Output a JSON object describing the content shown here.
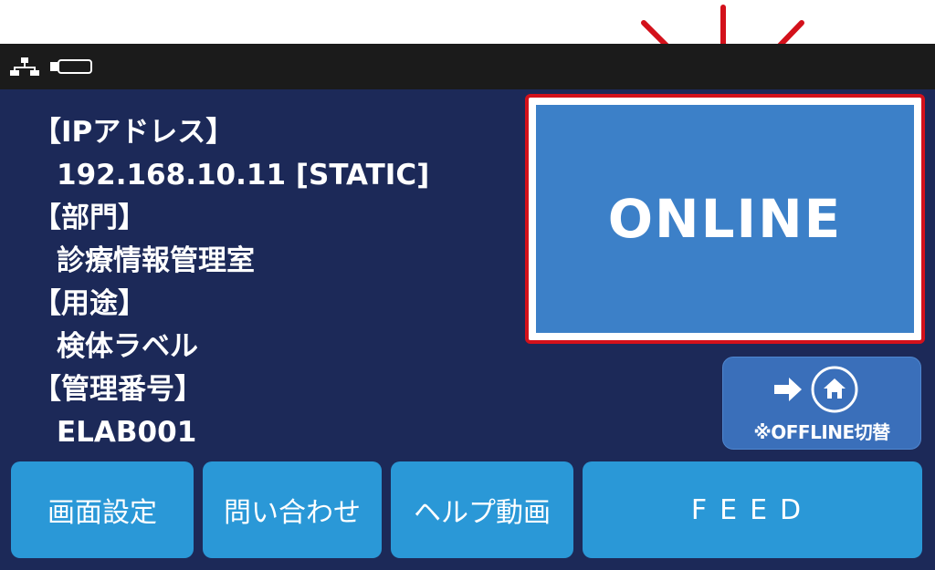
{
  "status_bar": {
    "network_icon": "network-icon",
    "storage_icon": "sd-card-icon"
  },
  "info": {
    "ip_label": "【IPアドレス】",
    "ip_value": "192.168.10.11 [STATIC]",
    "dept_label": "【部門】",
    "dept_value": "診療情報管理室",
    "use_label": "【用途】",
    "use_value": "検体ラベル",
    "mgmt_label": "【管理番号】",
    "mgmt_value": "ELAB001"
  },
  "status_panel": {
    "text": "ONLINE",
    "highlight_color": "#d3111b",
    "panel_color": "#3c80c8"
  },
  "offline_button": {
    "label": "※OFFLINE切替",
    "icons": [
      "arrow-right-icon",
      "home-icon"
    ]
  },
  "buttons": {
    "settings": "画面設定",
    "contact": "問い合わせ",
    "help_video": "ヘルプ動画",
    "feed": "FEED"
  },
  "colors": {
    "screen_bg": "#1c2958",
    "button_bg": "#2a98d7",
    "status_bar_bg": "#1b1b1b"
  }
}
